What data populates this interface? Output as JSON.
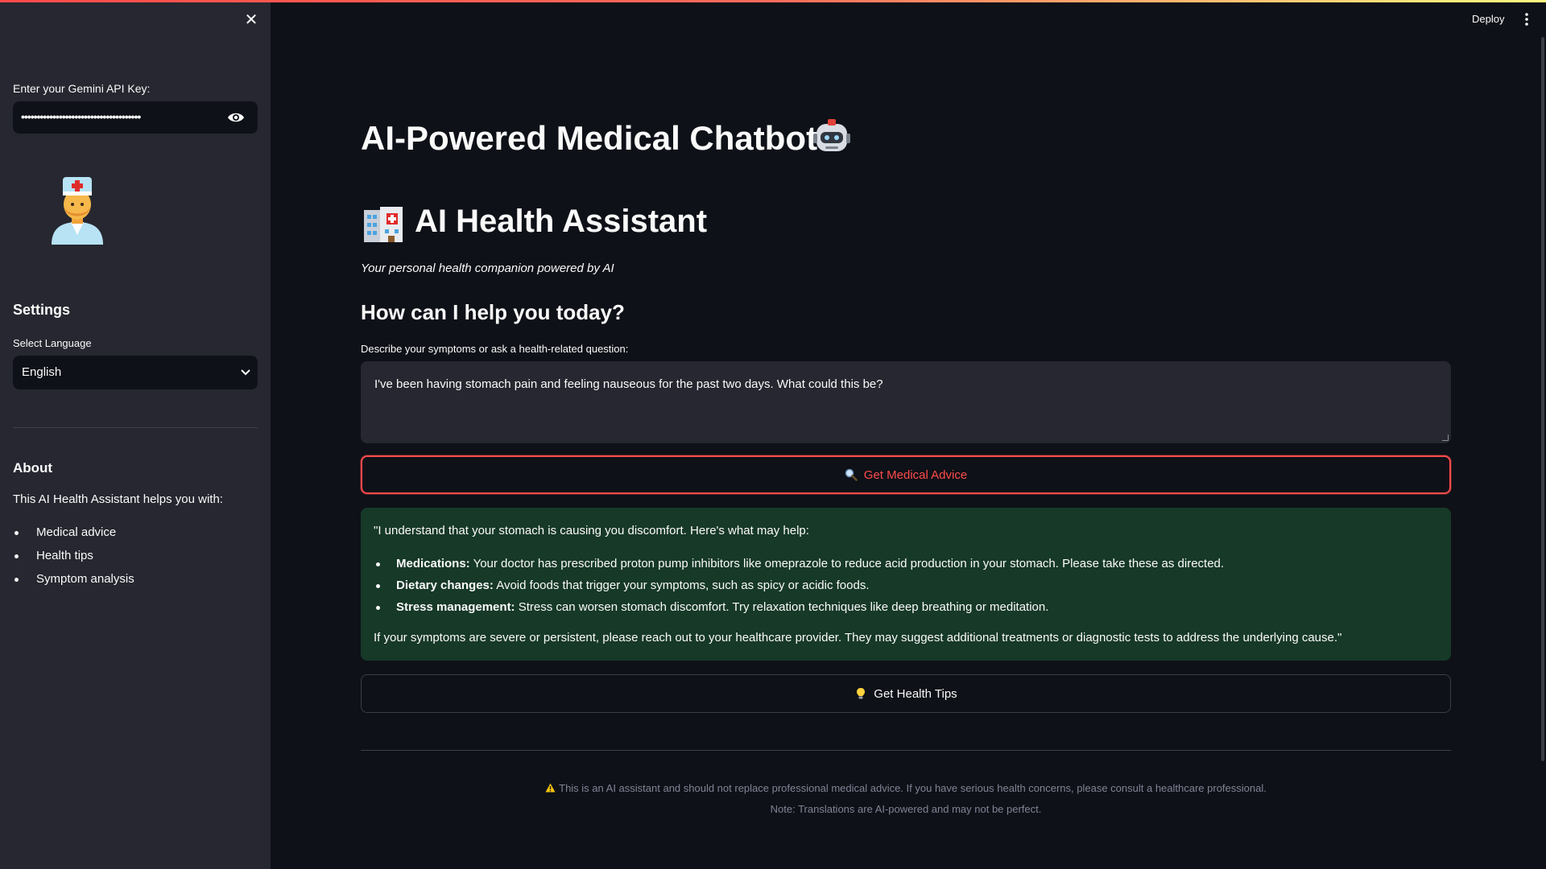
{
  "sidebar": {
    "close_icon": "close-icon",
    "api_key_label": "Enter your Gemini API Key:",
    "api_key_value": "••••••••••••••••••••••••••••••••••••••",
    "visibility_icon": "eye-icon",
    "avatar_icon": "health-worker-emoji",
    "settings_heading": "Settings",
    "language_label": "Select Language",
    "language_value": "English",
    "about_heading": "About",
    "about_text": "This AI Health Assistant helps you with:",
    "about_items": [
      "Medical advice",
      "Health tips",
      "Symptom analysis"
    ]
  },
  "header": {
    "deploy_label": "Deploy",
    "menu_icon": "kebab-menu-icon"
  },
  "main": {
    "title": "AI-Powered Medical Chatbot",
    "title_icon": "robot-emoji",
    "heading": "AI Health Assistant",
    "heading_icon": "hospital-emoji",
    "subtitle": "Your personal health companion powered by AI",
    "prompt_heading": "How can I help you today?",
    "input_label": "Describe your symptoms or ask a health-related question:",
    "input_value": "I've been having stomach pain and feeling nauseous for the past two days. What could this be?",
    "advice_button": "Get Medical Advice",
    "advice_button_icon": "magnifier-icon",
    "answer": {
      "intro": "\"I understand that your stomach is causing you discomfort. Here's what may help:",
      "items": [
        {
          "title": "Medications:",
          "text": " Your doctor has prescribed proton pump inhibitors like omeprazole to reduce acid production in your stomach. Please take these as directed."
        },
        {
          "title": "Dietary changes:",
          "text": " Avoid foods that trigger your symptoms, such as spicy or acidic foods."
        },
        {
          "title": "Stress management:",
          "text": " Stress can worsen stomach discomfort. Try relaxation techniques like deep breathing or meditation."
        }
      ],
      "outro": "If your symptoms are severe or persistent, please reach out to your healthcare provider. They may suggest additional treatments or diagnostic tests to address the underlying cause.\""
    },
    "tips_button": "Get Health Tips",
    "tips_button_icon": "lightbulb-icon",
    "disclaimer": "This is an AI assistant and should not replace professional medical advice. If you have serious health concerns, please consult a healthcare professional.",
    "disclaimer_icon": "warning-icon",
    "translation_note": "Note: Translations are AI-powered and may not be perfect."
  },
  "colors": {
    "accent": "#ff4b4b",
    "background": "#0e1117",
    "sidebar": "#262730",
    "success_bg": "#173928"
  }
}
